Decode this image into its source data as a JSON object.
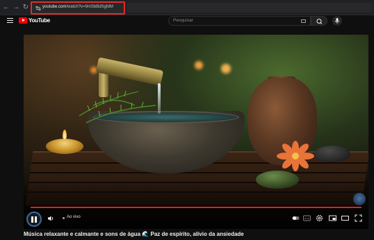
{
  "browser": {
    "url_host": "youtube.com",
    "url_path": "/watch?v=9mSbBdSgfdM"
  },
  "masthead": {
    "logo_text": "YouTube",
    "logo_superscript": "PT",
    "search_placeholder": "Pesquisar"
  },
  "player": {
    "live_label": "Ao vivo",
    "icons": [
      "pause-icon",
      "volume-icon",
      "autoplay-toggle-icon",
      "subtitles-icon",
      "settings-icon",
      "miniplayer-icon",
      "theater-icon",
      "cast-icon",
      "fullscreen-icon"
    ]
  },
  "video": {
    "title": "Música relaxante e calmante e sons de água 🌊 Paz de espírito, alívio da ansiedade"
  },
  "colors": {
    "brand_red": "#ff0000",
    "progress": "#e22020",
    "highlight_border": "#e22d2d"
  }
}
